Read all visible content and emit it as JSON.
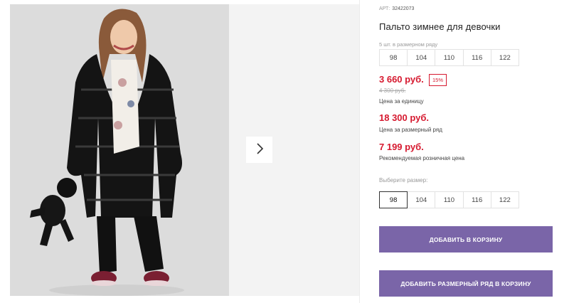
{
  "product": {
    "article_label": "АРТ:",
    "article_number": "32422073",
    "title": "Пальто зимнее для девочки",
    "series_note": "5 шт. в размерном ряду",
    "series_sizes": [
      "98",
      "104",
      "110",
      "116",
      "122"
    ]
  },
  "pricing": {
    "unit_price": "3 660 руб.",
    "discount_badge": "15%",
    "old_price": "4 300 руб.",
    "unit_label": "Цена за единицу",
    "series_price": "18 300 руб.",
    "series_label": "Цена за размерный ряд",
    "retail_price": "7 199 руб.",
    "retail_label": "Рекомендуемая розничная цена"
  },
  "size_picker": {
    "label": "Выберите размер:",
    "sizes": [
      "98",
      "104",
      "110",
      "116",
      "122"
    ],
    "selected": "98"
  },
  "actions": {
    "add_to_cart": "ДОБАВИТЬ В КОРЗИНУ",
    "add_series_to_cart": "ДОБАВИТЬ РАЗМЕРНЫЙ РЯД В КОРЗИНУ"
  },
  "gallery": {
    "next_icon": "chevron-right-icon"
  },
  "colors": {
    "accent_button": "#7a65a8",
    "price_red": "#d6192f"
  }
}
